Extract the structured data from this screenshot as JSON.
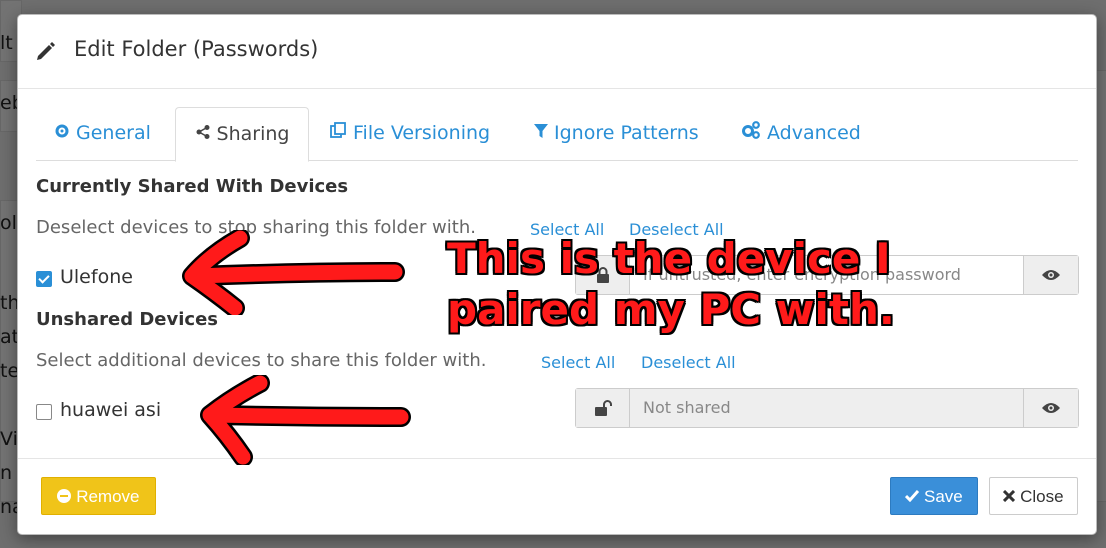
{
  "dialog": {
    "title": "Edit Folder (Passwords)"
  },
  "tabs": [
    {
      "label": "General",
      "icon": "gear-icon"
    },
    {
      "label": "Sharing",
      "icon": "share-icon"
    },
    {
      "label": "File Versioning",
      "icon": "copy-icon"
    },
    {
      "label": "Ignore Patterns",
      "icon": "filter-icon"
    },
    {
      "label": "Advanced",
      "icon": "cogs-icon"
    }
  ],
  "shared": {
    "heading": "Currently Shared With Devices",
    "help": "Deselect devices to stop sharing this folder with.",
    "select_all": "Select All",
    "deselect_all": "Deselect All",
    "devices": [
      {
        "name": "Ulefone",
        "checked": true,
        "password_placeholder": "If untrusted, enter encryption password"
      }
    ]
  },
  "unshared": {
    "heading": "Unshared Devices",
    "help": "Select additional devices to share this folder with.",
    "select_all": "Select All",
    "deselect_all": "Deselect All",
    "devices": [
      {
        "name": "huawei asi",
        "checked": false,
        "password_placeholder": "Not shared"
      }
    ]
  },
  "footer": {
    "remove": "Remove",
    "save": "Save",
    "close": "Close"
  },
  "annotation": {
    "line1": "This is the device I",
    "line2": "paired my PC with.",
    "color": "#ff1a1a"
  },
  "background": {
    "fragments": [
      "lt",
      "eb",
      "ol",
      "th",
      "at",
      "te",
      "Vit",
      "n",
      "na"
    ]
  },
  "colors": {
    "link": "#2a8fd6",
    "remove": "#f0c419",
    "save": "#3a8fd9"
  }
}
